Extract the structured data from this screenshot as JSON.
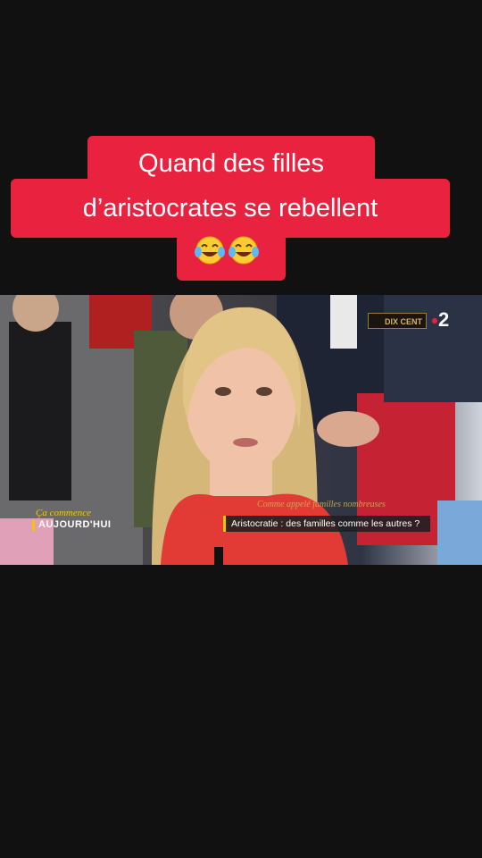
{
  "caption": {
    "line1": "Quand des filles",
    "line2": "d’aristocrates se rebellent",
    "emojis": [
      "face-with-tears-of-joy",
      "face-with-tears-of-joy"
    ]
  },
  "colors": {
    "background": "#111112",
    "caption_bg": "#e8223f",
    "caption_text": "#ffffff",
    "accent_yellow": "#f5c400"
  },
  "video": {
    "channel_logo": "2",
    "partner_logo": "DIX CENT",
    "show_logo_line1": "Ça commence",
    "show_logo_line2": "AUJOURD'HUI",
    "lower_third_top": "Comme appelé familles nombreuses",
    "lower_third_title": "Aristocratie : des familles comme les autres ?"
  }
}
